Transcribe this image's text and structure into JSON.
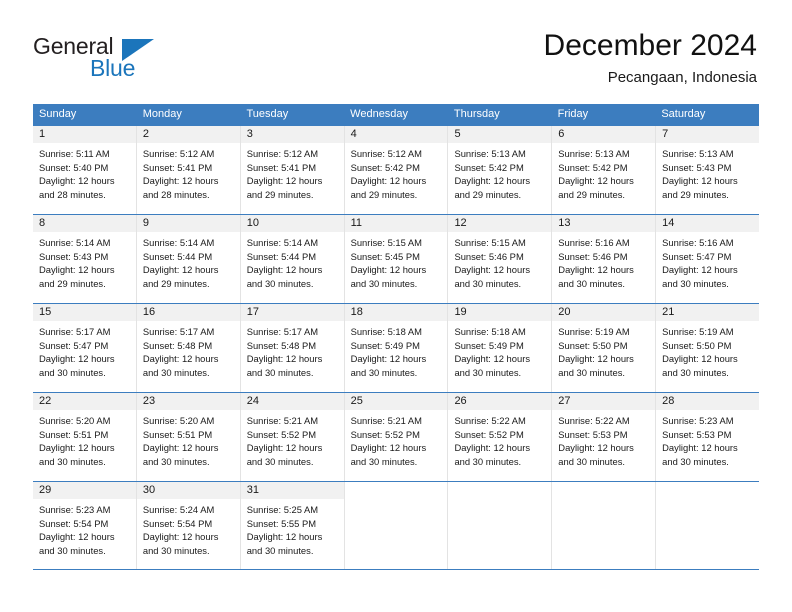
{
  "logo": {
    "word_one": "General",
    "word_two": "Blue",
    "triangle_icon": "blue-triangle-icon"
  },
  "header": {
    "title": "December 2024",
    "subtitle": "Pecangaan, Indonesia"
  },
  "colors": {
    "header_blue": "#3c7dbf",
    "logo_blue": "#1b75bb",
    "daynum_band": "#f1f1f1",
    "cell_divider": "#e3e3e3"
  },
  "weekdays": [
    "Sunday",
    "Monday",
    "Tuesday",
    "Wednesday",
    "Thursday",
    "Friday",
    "Saturday"
  ],
  "labels": {
    "sunrise_prefix": "Sunrise:",
    "sunset_prefix": "Sunset:",
    "daylight_prefix": "Daylight:"
  },
  "weeks": [
    [
      {
        "day": "1",
        "sunrise": "Sunrise: 5:11 AM",
        "sunset": "Sunset: 5:40 PM",
        "daylight": "Daylight: 12 hours and 28 minutes."
      },
      {
        "day": "2",
        "sunrise": "Sunrise: 5:12 AM",
        "sunset": "Sunset: 5:41 PM",
        "daylight": "Daylight: 12 hours and 28 minutes."
      },
      {
        "day": "3",
        "sunrise": "Sunrise: 5:12 AM",
        "sunset": "Sunset: 5:41 PM",
        "daylight": "Daylight: 12 hours and 29 minutes."
      },
      {
        "day": "4",
        "sunrise": "Sunrise: 5:12 AM",
        "sunset": "Sunset: 5:42 PM",
        "daylight": "Daylight: 12 hours and 29 minutes."
      },
      {
        "day": "5",
        "sunrise": "Sunrise: 5:13 AM",
        "sunset": "Sunset: 5:42 PM",
        "daylight": "Daylight: 12 hours and 29 minutes."
      },
      {
        "day": "6",
        "sunrise": "Sunrise: 5:13 AM",
        "sunset": "Sunset: 5:42 PM",
        "daylight": "Daylight: 12 hours and 29 minutes."
      },
      {
        "day": "7",
        "sunrise": "Sunrise: 5:13 AM",
        "sunset": "Sunset: 5:43 PM",
        "daylight": "Daylight: 12 hours and 29 minutes."
      }
    ],
    [
      {
        "day": "8",
        "sunrise": "Sunrise: 5:14 AM",
        "sunset": "Sunset: 5:43 PM",
        "daylight": "Daylight: 12 hours and 29 minutes."
      },
      {
        "day": "9",
        "sunrise": "Sunrise: 5:14 AM",
        "sunset": "Sunset: 5:44 PM",
        "daylight": "Daylight: 12 hours and 29 minutes."
      },
      {
        "day": "10",
        "sunrise": "Sunrise: 5:14 AM",
        "sunset": "Sunset: 5:44 PM",
        "daylight": "Daylight: 12 hours and 30 minutes."
      },
      {
        "day": "11",
        "sunrise": "Sunrise: 5:15 AM",
        "sunset": "Sunset: 5:45 PM",
        "daylight": "Daylight: 12 hours and 30 minutes."
      },
      {
        "day": "12",
        "sunrise": "Sunrise: 5:15 AM",
        "sunset": "Sunset: 5:46 PM",
        "daylight": "Daylight: 12 hours and 30 minutes."
      },
      {
        "day": "13",
        "sunrise": "Sunrise: 5:16 AM",
        "sunset": "Sunset: 5:46 PM",
        "daylight": "Daylight: 12 hours and 30 minutes."
      },
      {
        "day": "14",
        "sunrise": "Sunrise: 5:16 AM",
        "sunset": "Sunset: 5:47 PM",
        "daylight": "Daylight: 12 hours and 30 minutes."
      }
    ],
    [
      {
        "day": "15",
        "sunrise": "Sunrise: 5:17 AM",
        "sunset": "Sunset: 5:47 PM",
        "daylight": "Daylight: 12 hours and 30 minutes."
      },
      {
        "day": "16",
        "sunrise": "Sunrise: 5:17 AM",
        "sunset": "Sunset: 5:48 PM",
        "daylight": "Daylight: 12 hours and 30 minutes."
      },
      {
        "day": "17",
        "sunrise": "Sunrise: 5:17 AM",
        "sunset": "Sunset: 5:48 PM",
        "daylight": "Daylight: 12 hours and 30 minutes."
      },
      {
        "day": "18",
        "sunrise": "Sunrise: 5:18 AM",
        "sunset": "Sunset: 5:49 PM",
        "daylight": "Daylight: 12 hours and 30 minutes."
      },
      {
        "day": "19",
        "sunrise": "Sunrise: 5:18 AM",
        "sunset": "Sunset: 5:49 PM",
        "daylight": "Daylight: 12 hours and 30 minutes."
      },
      {
        "day": "20",
        "sunrise": "Sunrise: 5:19 AM",
        "sunset": "Sunset: 5:50 PM",
        "daylight": "Daylight: 12 hours and 30 minutes."
      },
      {
        "day": "21",
        "sunrise": "Sunrise: 5:19 AM",
        "sunset": "Sunset: 5:50 PM",
        "daylight": "Daylight: 12 hours and 30 minutes."
      }
    ],
    [
      {
        "day": "22",
        "sunrise": "Sunrise: 5:20 AM",
        "sunset": "Sunset: 5:51 PM",
        "daylight": "Daylight: 12 hours and 30 minutes."
      },
      {
        "day": "23",
        "sunrise": "Sunrise: 5:20 AM",
        "sunset": "Sunset: 5:51 PM",
        "daylight": "Daylight: 12 hours and 30 minutes."
      },
      {
        "day": "24",
        "sunrise": "Sunrise: 5:21 AM",
        "sunset": "Sunset: 5:52 PM",
        "daylight": "Daylight: 12 hours and 30 minutes."
      },
      {
        "day": "25",
        "sunrise": "Sunrise: 5:21 AM",
        "sunset": "Sunset: 5:52 PM",
        "daylight": "Daylight: 12 hours and 30 minutes."
      },
      {
        "day": "26",
        "sunrise": "Sunrise: 5:22 AM",
        "sunset": "Sunset: 5:52 PM",
        "daylight": "Daylight: 12 hours and 30 minutes."
      },
      {
        "day": "27",
        "sunrise": "Sunrise: 5:22 AM",
        "sunset": "Sunset: 5:53 PM",
        "daylight": "Daylight: 12 hours and 30 minutes."
      },
      {
        "day": "28",
        "sunrise": "Sunrise: 5:23 AM",
        "sunset": "Sunset: 5:53 PM",
        "daylight": "Daylight: 12 hours and 30 minutes."
      }
    ],
    [
      {
        "day": "29",
        "sunrise": "Sunrise: 5:23 AM",
        "sunset": "Sunset: 5:54 PM",
        "daylight": "Daylight: 12 hours and 30 minutes."
      },
      {
        "day": "30",
        "sunrise": "Sunrise: 5:24 AM",
        "sunset": "Sunset: 5:54 PM",
        "daylight": "Daylight: 12 hours and 30 minutes."
      },
      {
        "day": "31",
        "sunrise": "Sunrise: 5:25 AM",
        "sunset": "Sunset: 5:55 PM",
        "daylight": "Daylight: 12 hours and 30 minutes."
      },
      {
        "day": "",
        "sunrise": "",
        "sunset": "",
        "daylight": ""
      },
      {
        "day": "",
        "sunrise": "",
        "sunset": "",
        "daylight": ""
      },
      {
        "day": "",
        "sunrise": "",
        "sunset": "",
        "daylight": ""
      },
      {
        "day": "",
        "sunrise": "",
        "sunset": "",
        "daylight": ""
      }
    ]
  ]
}
